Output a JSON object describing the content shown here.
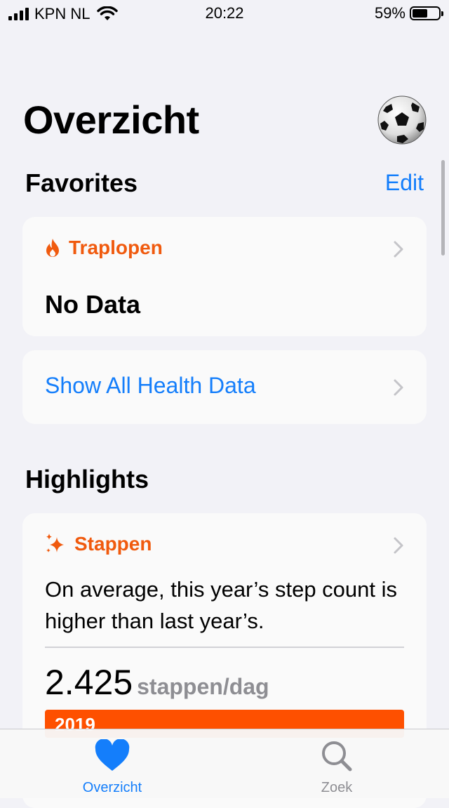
{
  "status_bar": {
    "carrier": "KPN NL",
    "time": "20:22",
    "battery_percent": "59%",
    "battery_level": 0.59,
    "signal_icon": "signal-bars-icon",
    "wifi_icon": "wifi-icon"
  },
  "header": {
    "title": "Overzicht",
    "avatar_icon": "soccer-ball-avatar"
  },
  "favorites": {
    "title": "Favorites",
    "edit_label": "Edit",
    "card": {
      "icon": "flame-icon",
      "label": "Traplopen",
      "value": "No Data"
    },
    "show_all_label": "Show All Health Data"
  },
  "highlights": {
    "title": "Highlights",
    "card": {
      "icon": "sparkles-icon",
      "label": "Stappen",
      "text": "On average, this year’s step count is higher than last year’s.",
      "value": "2.425",
      "unit": "stappen/dag",
      "bar_label": "2019"
    }
  },
  "tab_bar": {
    "tabs": [
      {
        "label": "Overzicht",
        "icon": "heart-icon",
        "selected": true
      },
      {
        "label": "Zoek",
        "icon": "search-icon",
        "selected": false
      }
    ]
  },
  "colors": {
    "accent": "#147efb",
    "orange": "#f05a0e",
    "bar": "#fe5000",
    "background": "#f2f2f7",
    "card": "#fafafa"
  }
}
